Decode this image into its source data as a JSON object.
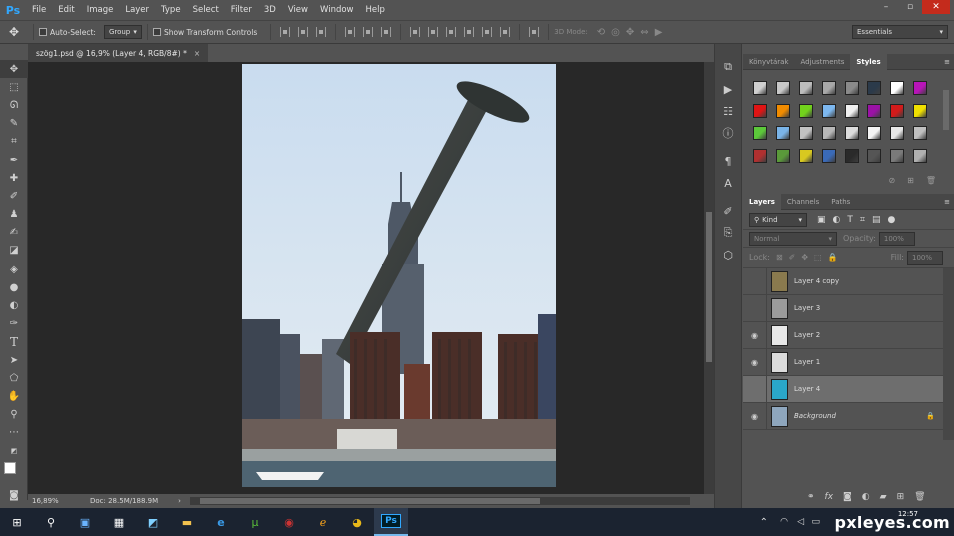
{
  "app": {
    "logo": "Ps",
    "menu": [
      "File",
      "Edit",
      "Image",
      "Layer",
      "Type",
      "Select",
      "Filter",
      "3D",
      "View",
      "Window",
      "Help"
    ],
    "window_controls": [
      "–",
      "▫",
      "✕"
    ]
  },
  "options": {
    "auto_select_label": "Auto-Select:",
    "auto_select_target": "Group",
    "show_transform_label": "Show Transform Controls",
    "mode_3d_label": "3D Mode:",
    "workspace": "Essentials"
  },
  "document": {
    "tab_title": "szög1.psd @ 16,9% (Layer 4, RGB/8#) *",
    "tab_close": "×",
    "zoom": "16,89%",
    "doc_info": "Doc: 28.5M/188.9M"
  },
  "panels": {
    "top_tabs": [
      "Könyvtárak",
      "Adjustments",
      "Styles"
    ],
    "layers_tabs": [
      "Layers",
      "Channels",
      "Paths"
    ],
    "kind_label": "Kind",
    "blend_mode": "Normal",
    "opacity_label": "Opacity:",
    "opacity_value": "100%",
    "lock_label": "Lock:",
    "fill_label": "Fill:",
    "fill_value": "100%",
    "layers": [
      {
        "name": "Layer 4 copy",
        "visible": false,
        "italic": false,
        "selected": false,
        "thumb": "#8a7a4e"
      },
      {
        "name": "Layer 3",
        "visible": false,
        "italic": false,
        "selected": false,
        "thumb": "#9b9b9b"
      },
      {
        "name": "Layer 2",
        "visible": true,
        "italic": false,
        "selected": false,
        "thumb": "#e8e8e8"
      },
      {
        "name": "Layer 1",
        "visible": true,
        "italic": false,
        "selected": false,
        "thumb": "#dcdcdc"
      },
      {
        "name": "Layer 4",
        "visible": false,
        "italic": false,
        "selected": true,
        "thumb": "#2aa7c9"
      },
      {
        "name": "Background",
        "visible": true,
        "italic": true,
        "selected": false,
        "thumb": "#8ea6bd",
        "locked": true
      }
    ],
    "bottom_icons": [
      "link-icon",
      "fx-icon",
      "mask-icon",
      "adjustment-icon",
      "group-icon",
      "new-layer-icon",
      "trash-icon"
    ]
  },
  "styles_swatches": [
    "#d0d0d0",
    "#c8c8c8",
    "#bcbcbc",
    "#a8a8a8",
    "#8a8a8a",
    "#2b3a4a",
    "#ffffff",
    "#b815b8",
    "#e01414",
    "#f28c00",
    "#72d21c",
    "#7db8f0",
    "#f0f0f0",
    "#9b12a6",
    "#d21b1b",
    "#f0e000",
    "#5cc83a",
    "#7ab4e8",
    "#c2c2c2",
    "#b8b8b8",
    "#dcdcdc",
    "#f4f4f4",
    "#e8e8e8",
    "#c0c0c0",
    "#b03030",
    "#5a9a3a",
    "#d8c820",
    "#3a6ab8",
    "#2a2a2a",
    "#555555",
    "#7a7a7a",
    "#b0b0b0"
  ],
  "taskbar": {
    "items": [
      "windows-icon",
      "search-icon",
      "media-icon",
      "calculator-icon",
      "notepad-icon",
      "explorer-icon",
      "edge-icon",
      "utorrent-icon",
      "app-icon",
      "ie-icon",
      "chrome-icon",
      "photoshop-icon"
    ],
    "ps_label": "Ps",
    "clock": "12:57",
    "watermark": "pxleyes.com"
  }
}
